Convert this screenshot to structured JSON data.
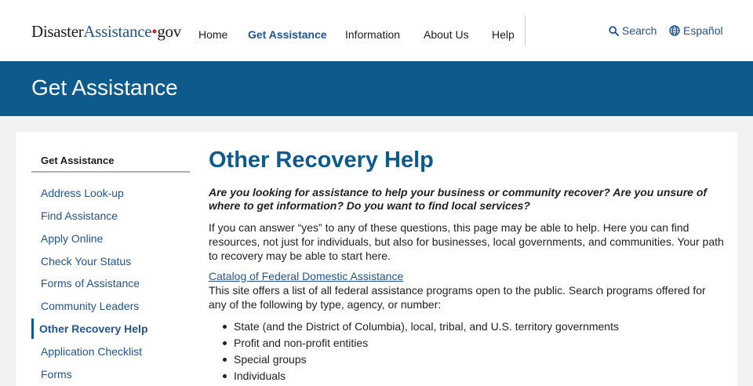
{
  "header": {
    "logo": {
      "part1": "Disaster",
      "part2": "Assistance",
      "dot": "•",
      "part3": "gov"
    },
    "nav": [
      "Home",
      "Get Assistance",
      "Information",
      "About Us",
      "Help"
    ],
    "active_nav": "Get Assistance",
    "search_label": "Search",
    "language_label": "Español",
    "icons": {
      "search": "search-icon",
      "language": "globe-icon"
    }
  },
  "hero": {
    "title": "Get Assistance"
  },
  "sidebar": {
    "heading": "Get Assistance",
    "items": [
      "Address Look-up",
      "Find Assistance",
      "Apply Online",
      "Check Your Status",
      "Forms of Assistance",
      "Community Leaders",
      "Other Recovery Help",
      "Application Checklist",
      "Forms"
    ],
    "current": "Other Recovery Help"
  },
  "main": {
    "title": "Other Recovery Help",
    "lead": "Are you looking for assistance to help your business or community recover? Are you unsure of where to get information? Do you want to find local services?",
    "intro": "If you can answer “yes” to any of these questions, this page may be able to help. Here you can find resources, not just for individuals, but also for businesses, local governments, and communities. Your path to recovery may be able to start here.",
    "catalog_link": "Catalog of Federal Domestic Assistance",
    "catalog_text": "This site offers a list of all federal assistance programs open to the public. Search programs offered for any of the following by type, agency, or number:",
    "bullets": [
      "State (and the District of Columbia), local, tribal, and U.S. territory governments",
      "Profit and non-profit entities",
      "Special groups",
      "Individuals"
    ]
  },
  "colors": {
    "brand_blue": "#0d5a8c",
    "link_blue": "#205493",
    "accent_red": "#c0282f",
    "background": "#f1f1f1"
  }
}
